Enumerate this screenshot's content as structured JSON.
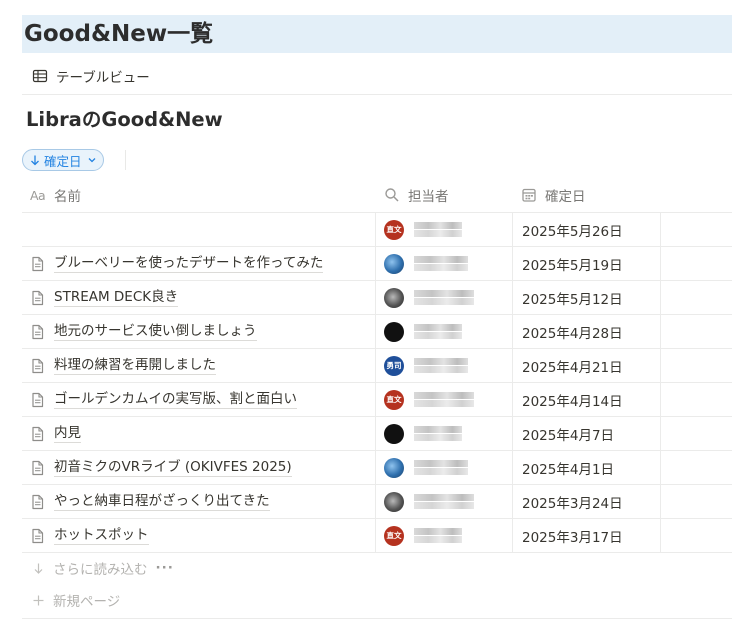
{
  "page": {
    "title": "Good&New一覧"
  },
  "view": {
    "label": "テーブルビュー",
    "icon": "table-icon"
  },
  "database": {
    "title": "LibraのGood&New"
  },
  "sort": {
    "label": "確定日",
    "icon": "arrow-down-icon",
    "chevron": "chevron-down-icon"
  },
  "columns": {
    "name": {
      "label": "名前",
      "type_badge": "Aa"
    },
    "assignee": {
      "label": "担当者",
      "icon": "person-search-icon"
    },
    "date": {
      "label": "確定日",
      "icon": "calendar-icon"
    }
  },
  "rows": [
    {
      "name": "",
      "avatar": "red",
      "avatar_text": "直文",
      "date": "2025年5月26日"
    },
    {
      "name": "ブルーベリーを使ったデザートを作ってみた",
      "avatar": "globe",
      "avatar_text": "",
      "date": "2025年5月19日"
    },
    {
      "name": "STREAM DECK良き",
      "avatar": "gray",
      "avatar_text": "",
      "date": "2025年5月12日"
    },
    {
      "name": "地元のサービス使い倒しましょう",
      "avatar": "black",
      "avatar_text": "",
      "date": "2025年4月28日"
    },
    {
      "name": "料理の練習を再開しました",
      "avatar": "blue",
      "avatar_text": "勇司",
      "date": "2025年4月21日"
    },
    {
      "name": "ゴールデンカムイの実写版、割と面白い",
      "avatar": "red",
      "avatar_text": "直文",
      "date": "2025年4月14日"
    },
    {
      "name": "内見",
      "avatar": "black",
      "avatar_text": "",
      "date": "2025年4月7日"
    },
    {
      "name": "初音ミクのVRライブ (OKIVFES 2025)",
      "avatar": "globe",
      "avatar_text": "",
      "date": "2025年4月1日"
    },
    {
      "name": "やっと納車日程がざっくり出てきた",
      "avatar": "gray",
      "avatar_text": "",
      "date": "2025年3月24日"
    },
    {
      "name": "ホットスポット",
      "avatar": "red",
      "avatar_text": "直文",
      "date": "2025年3月17日"
    }
  ],
  "footer": {
    "load_more": "さらに読み込む",
    "more_options": "···",
    "new_page": "新規ページ"
  },
  "colors": {
    "title_bg": "#e3eff8",
    "accent": "#2383e2",
    "text": "#37352f",
    "muted": "#787774"
  }
}
